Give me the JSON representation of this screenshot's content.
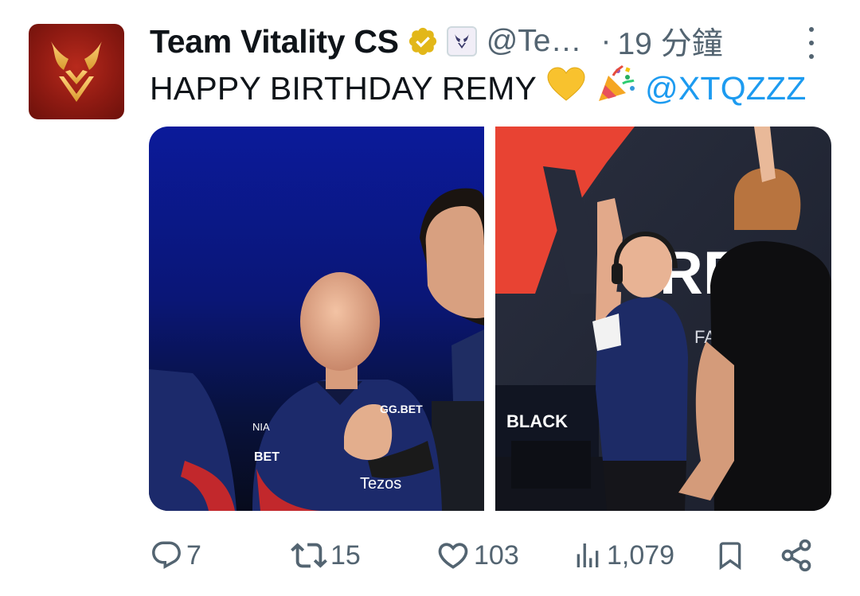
{
  "tweet": {
    "display_name": "Team Vitality CS",
    "handle": "@Te…",
    "separator": "·",
    "time": "19 分鐘",
    "text": "HAPPY BIRTHDAY REMY",
    "emojis": [
      "yellow-heart",
      "party-popper"
    ],
    "mention": "@XTQZZZ",
    "photo_left_text": {
      "sponsor_1": "GG.BET",
      "sponsor_2": "BET",
      "sponsor_3": "Tezos",
      "sponsor_4": "NIA"
    },
    "photo_right_text": {
      "banner": "BLACK",
      "letters": "RE",
      "sub": "FA"
    }
  },
  "actions": {
    "replies": "7",
    "retweets": "15",
    "likes": "103",
    "views": "1,079"
  },
  "colors": {
    "accent": "#1d9bf0",
    "secondary_text": "#536471",
    "verified_gold": "#e2b719",
    "avatar_red": "#8e1a12"
  }
}
